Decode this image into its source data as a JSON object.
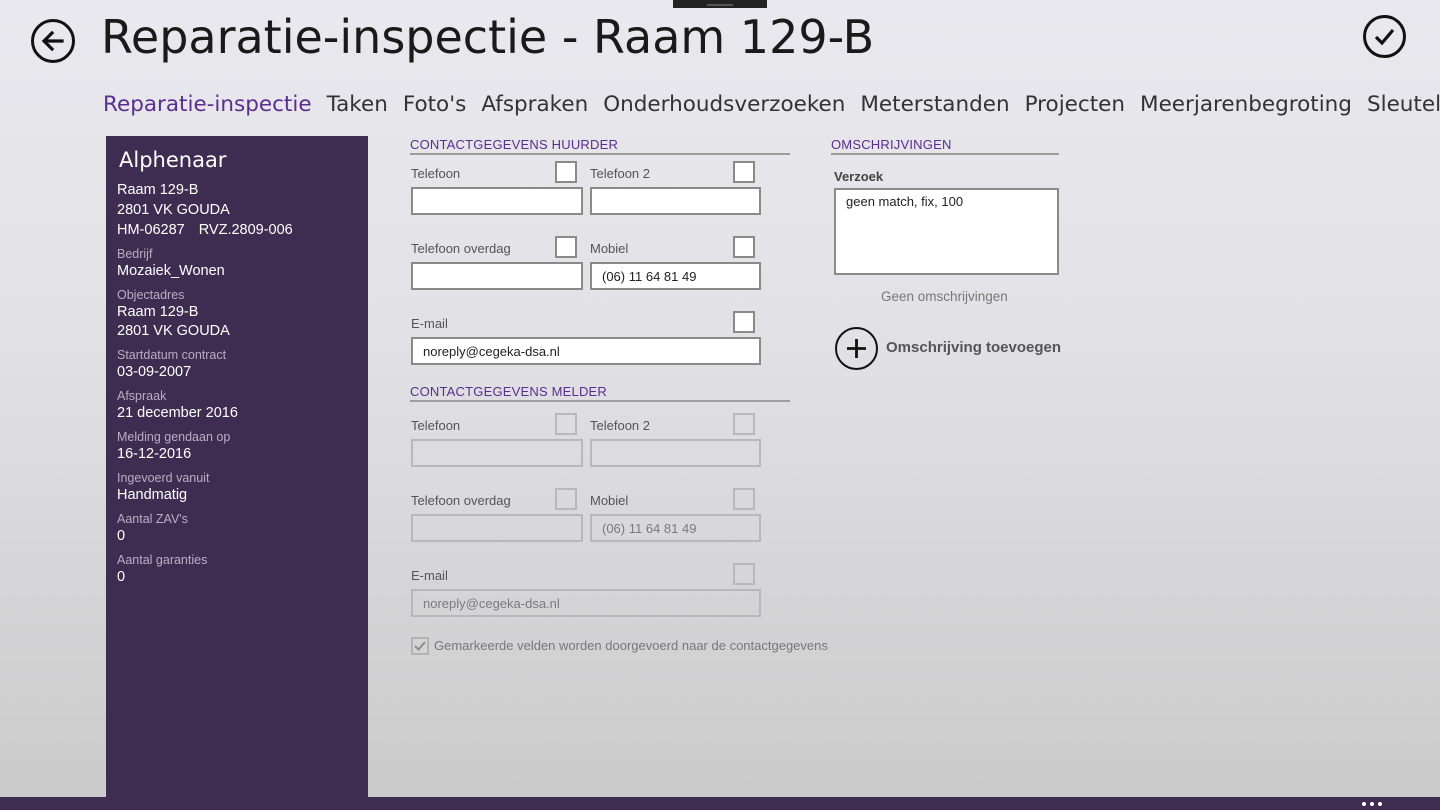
{
  "header": {
    "title": "Reparatie-inspectie - Raam 129-B"
  },
  "tabs": [
    {
      "label": "Reparatie-inspectie",
      "active": true
    },
    {
      "label": "Taken"
    },
    {
      "label": "Foto's"
    },
    {
      "label": "Afspraken"
    },
    {
      "label": "Onderhoudsverzoeken"
    },
    {
      "label": "Meterstanden"
    },
    {
      "label": "Projecten"
    },
    {
      "label": "Meerjarenbegroting"
    },
    {
      "label": "Sleutels"
    }
  ],
  "sidebar": {
    "name": "Alphenaar",
    "address_line1": "Raam 129-B",
    "address_line2": "2801 VK GOUDA",
    "id1": "HM-06287",
    "id2": "RVZ.2809-006",
    "fields": [
      {
        "label": "Bedrijf",
        "value": "Mozaiek_Wonen"
      },
      {
        "label": "Objectadres",
        "value": "Raam 129-B",
        "value2": "2801 VK GOUDA"
      },
      {
        "label": "Startdatum contract",
        "value": "03-09-2007"
      },
      {
        "label": "Afspraak",
        "value": "21 december 2016"
      },
      {
        "label": "Melding gendaan op",
        "value": "16-12-2016"
      },
      {
        "label": "Ingevoerd vanuit",
        "value": "Handmatig"
      },
      {
        "label": "Aantal ZAV's",
        "value": "0"
      },
      {
        "label": "Aantal garanties",
        "value": "0"
      }
    ]
  },
  "huurder": {
    "heading": "CONTACTGEGEVENS HUURDER",
    "telefoon_label": "Telefoon",
    "telefoon_value": "",
    "telefoon2_label": "Telefoon 2",
    "telefoon2_value": "",
    "overdag_label": "Telefoon overdag",
    "overdag_value": "",
    "mobiel_label": "Mobiel",
    "mobiel_value": "(06) 11 64 81 49",
    "email_label": "E-mail",
    "email_value": "noreply@cegeka-dsa.nl"
  },
  "melder": {
    "heading": "CONTACTGEGEVENS MELDER",
    "telefoon_label": "Telefoon",
    "telefoon_value": "",
    "telefoon2_label": "Telefoon 2",
    "telefoon2_value": "",
    "overdag_label": "Telefoon overdag",
    "overdag_value": "",
    "mobiel_label": "Mobiel",
    "mobiel_value": "(06) 11 64 81 49",
    "email_label": "E-mail",
    "email_value": "noreply@cegeka-dsa.nl"
  },
  "note": {
    "checked": true,
    "text": "Gemarkeerde velden worden doorgevoerd naar de contactgegevens"
  },
  "omschrijvingen": {
    "heading": "OMSCHRIJVINGEN",
    "verzoek_label": "Verzoek",
    "verzoek_value": "geen match, fix, 100",
    "empty_text": "Geen omschrijvingen",
    "add_label": "Omschrijving toevoegen"
  },
  "colors": {
    "accent": "#5b2d8e",
    "sidebar_bg": "#3f2d51"
  }
}
